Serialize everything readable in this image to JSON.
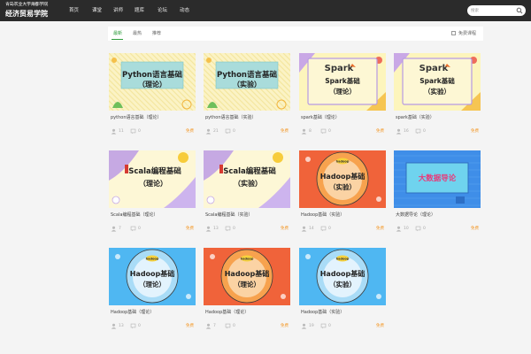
{
  "header": {
    "logo_line1": "青岛农业大学海都学院",
    "logo_line2": "经济贸易学院",
    "nav": [
      "首页",
      "课堂",
      "讲师",
      "题库",
      "论坛",
      "动态"
    ],
    "search_placeholder": "搜索"
  },
  "filters": {
    "tabs": [
      "最新",
      "最热",
      "推荐"
    ],
    "active_tab": "最新",
    "free_only_label": "免费课程"
  },
  "courses": [
    {
      "title": "python语言基础（理论）",
      "thumb_lines": [
        "Python语言基础",
        "（理论）"
      ],
      "students": "11",
      "comments": "0",
      "price": "免费",
      "theme": "python"
    },
    {
      "title": "python语言基础（实验）",
      "thumb_lines": [
        "Python语言基础",
        "（实验）"
      ],
      "students": "21",
      "comments": "0",
      "price": "免费",
      "theme": "python"
    },
    {
      "title": "spark基础（理论）",
      "thumb_lines": [
        "Spark",
        "Spark基础",
        "（理论）"
      ],
      "students": "8",
      "comments": "0",
      "price": "免费",
      "theme": "spark"
    },
    {
      "title": "spark基础（实验）",
      "thumb_lines": [
        "Spark",
        "Spark基础",
        "（实验）"
      ],
      "students": "16",
      "comments": "0",
      "price": "免费",
      "theme": "spark"
    },
    {
      "title": "Scala编程基础（理论）",
      "thumb_lines": [
        "Scala编程基础",
        "（理论）"
      ],
      "students": "7",
      "comments": "0",
      "price": "免费",
      "theme": "scala"
    },
    {
      "title": "Scala编程基础（实验）",
      "thumb_lines": [
        "Scala编程基础",
        "（实验）"
      ],
      "students": "13",
      "comments": "0",
      "price": "免费",
      "theme": "scala"
    },
    {
      "title": "Hadoop基础（实验）",
      "thumb_lines": [
        "hadoop",
        "Hadoop基础",
        "（实验）"
      ],
      "students": "14",
      "comments": "0",
      "price": "免费",
      "theme": "hadoop-red"
    },
    {
      "title": "大数据导论（理论）",
      "thumb_lines": [
        "大数据导论"
      ],
      "students": "10",
      "comments": "0",
      "price": "免费",
      "theme": "bigdata"
    },
    {
      "title": "Hadoop基础（理论）",
      "thumb_lines": [
        "hadoop",
        "Hadoop基础",
        "（理论）"
      ],
      "students": "13",
      "comments": "0",
      "price": "免费",
      "theme": "hadoop-blue"
    },
    {
      "title": "Hadoop基础（理论）",
      "thumb_lines": [
        "hadoop",
        "Hadoop基础",
        "（理论）"
      ],
      "students": "7",
      "comments": "0",
      "price": "免费",
      "theme": "hadoop-red"
    },
    {
      "title": "Hadoop基础（实验）",
      "thumb_lines": [
        "hadoop",
        "Hadoop基础",
        "（实验）"
      ],
      "students": "19",
      "comments": "0",
      "price": "免费",
      "theme": "hadoop-blue"
    }
  ],
  "icons": {
    "students": "user-icon",
    "comments": "comment-icon",
    "search": "search-icon"
  },
  "colors": {
    "topbar": "#2b2b2b",
    "accent_green": "#2e9c3c",
    "price_orange": "#f39a2b"
  }
}
